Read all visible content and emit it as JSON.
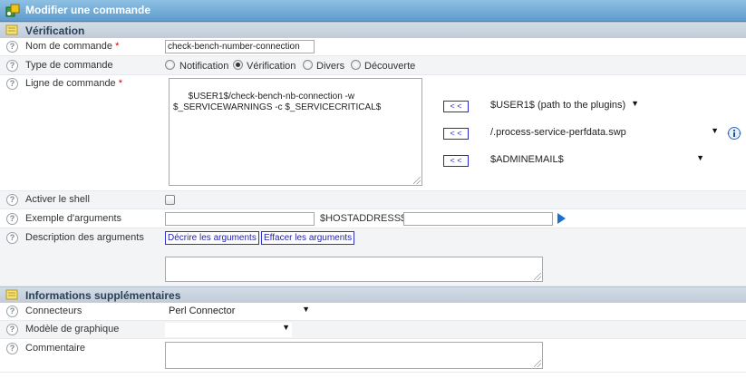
{
  "header": {
    "title": "Modifier une commande"
  },
  "sections": {
    "verification": {
      "title": "Vérification"
    },
    "extra": {
      "title": "Informations supplémentaires"
    }
  },
  "fields": {
    "command_name": {
      "label": "Nom de commande",
      "required": "*",
      "value": "check-bench-number-connection"
    },
    "command_type": {
      "label": "Type de commande",
      "options": [
        "Notification",
        "Vérification",
        "Divers",
        "Découverte"
      ],
      "selected": "Vérification"
    },
    "command_line": {
      "label": "Ligne de commande",
      "required": "*",
      "value": "$USER1$/check-bench-nb-connection -w\n$_SERVICEWARNINGS -c $_SERVICECRITICAL$",
      "insert_label": "< <",
      "macros": [
        "$USER1$ (path to the plugins)",
        "/.process-service-perfdata.swp",
        "$ADMINEMAIL$"
      ]
    },
    "enable_shell": {
      "label": "Activer le shell",
      "checked": false
    },
    "args_example": {
      "label": "Exemple d'arguments",
      "value": "",
      "host_label": "$HOSTADDRESS$",
      "host_value": ""
    },
    "args_description": {
      "label": "Description des arguments",
      "describe_label": "Décrire les arguments",
      "clear_label": "Effacer les arguments",
      "value": ""
    },
    "connectors": {
      "label": "Connecteurs",
      "value": "Perl Connector"
    },
    "graph_template": {
      "label": "Modèle de graphique",
      "value": ""
    },
    "comment": {
      "label": "Commentaire",
      "value": ""
    }
  },
  "icons": {
    "help": "help-icon",
    "info": "info-icon",
    "play": "play-icon"
  },
  "colors": {
    "title_bar": "#6aa5d3",
    "section": "#c9d3de",
    "link": "#2222aa",
    "play": "#1a6fd0"
  }
}
